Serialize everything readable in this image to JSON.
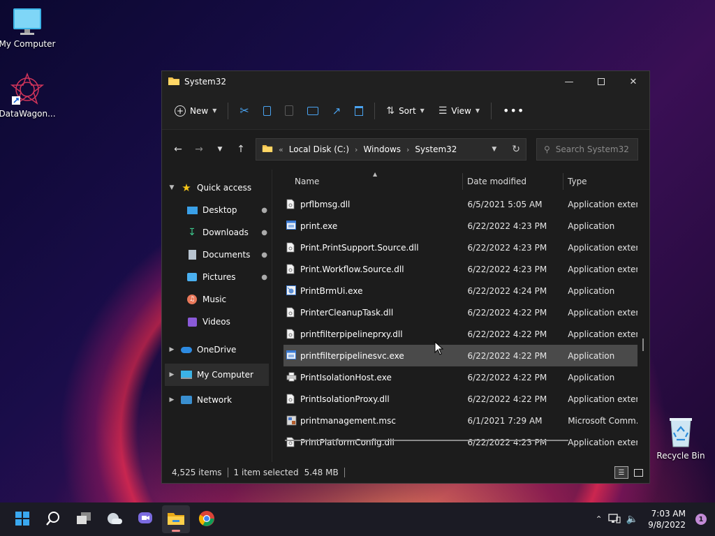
{
  "desktop": {
    "icons": [
      {
        "label": "My Computer"
      },
      {
        "label": "DataWagon..."
      },
      {
        "label": "Recycle Bin"
      }
    ]
  },
  "window": {
    "title": "System32",
    "toolbar": {
      "new_label": "New",
      "sort_label": "Sort",
      "view_label": "View"
    },
    "address": {
      "segments": [
        "Local Disk (C:)",
        "Windows",
        "System32"
      ],
      "search_placeholder": "Search System32"
    },
    "nav": {
      "quick_access": "Quick access",
      "items": [
        {
          "label": "Desktop",
          "icon": "desktop-icon",
          "pinned": true
        },
        {
          "label": "Downloads",
          "icon": "downloads-icon",
          "pinned": true
        },
        {
          "label": "Documents",
          "icon": "documents-icon",
          "pinned": true
        },
        {
          "label": "Pictures",
          "icon": "pictures-icon",
          "pinned": true
        },
        {
          "label": "Music",
          "icon": "music-icon",
          "pinned": false
        },
        {
          "label": "Videos",
          "icon": "videos-icon",
          "pinned": false
        }
      ],
      "onedrive": "OneDrive",
      "my_computer": "My Computer",
      "network": "Network"
    },
    "columns": {
      "name": "Name",
      "date": "Date modified",
      "type": "Type"
    },
    "files": [
      {
        "name": "prflbmsg.dll",
        "date": "6/5/2021 5:05 AM",
        "type": "Application exten...",
        "kind": "dll"
      },
      {
        "name": "print.exe",
        "date": "6/22/2022 4:23 PM",
        "type": "Application",
        "kind": "exe"
      },
      {
        "name": "Print.PrintSupport.Source.dll",
        "date": "6/22/2022 4:23 PM",
        "type": "Application exten...",
        "kind": "dll"
      },
      {
        "name": "Print.Workflow.Source.dll",
        "date": "6/22/2022 4:23 PM",
        "type": "Application exten...",
        "kind": "dll"
      },
      {
        "name": "PrintBrmUi.exe",
        "date": "6/22/2022 4:24 PM",
        "type": "Application",
        "kind": "exe2"
      },
      {
        "name": "PrinterCleanupTask.dll",
        "date": "6/22/2022 4:22 PM",
        "type": "Application exten...",
        "kind": "dll"
      },
      {
        "name": "printfilterpipelineprxy.dll",
        "date": "6/22/2022 4:22 PM",
        "type": "Application exten...",
        "kind": "dll"
      },
      {
        "name": "printfilterpipelinesvc.exe",
        "date": "6/22/2022 4:22 PM",
        "type": "Application",
        "kind": "exe",
        "selected": true
      },
      {
        "name": "PrintIsolationHost.exe",
        "date": "6/22/2022 4:22 PM",
        "type": "Application",
        "kind": "printer"
      },
      {
        "name": "PrintIsolationProxy.dll",
        "date": "6/22/2022 4:22 PM",
        "type": "Application exten...",
        "kind": "dll"
      },
      {
        "name": "printmanagement.msc",
        "date": "6/1/2021 7:29 AM",
        "type": "Microsoft Comm...",
        "kind": "msc"
      },
      {
        "name": "PrintPlatformConfig.dll",
        "date": "6/22/2022 4:23 PM",
        "type": "Application exten...",
        "kind": "dll"
      }
    ],
    "status": {
      "count": "4,525 items",
      "selected": "1 item selected",
      "size": "5.48 MB"
    }
  },
  "taskbar": {
    "time": "7:03 AM",
    "date": "9/8/2022",
    "notifications": "1"
  },
  "colors": {
    "accent": "#0078d4",
    "selection": "#4a4a4a"
  }
}
